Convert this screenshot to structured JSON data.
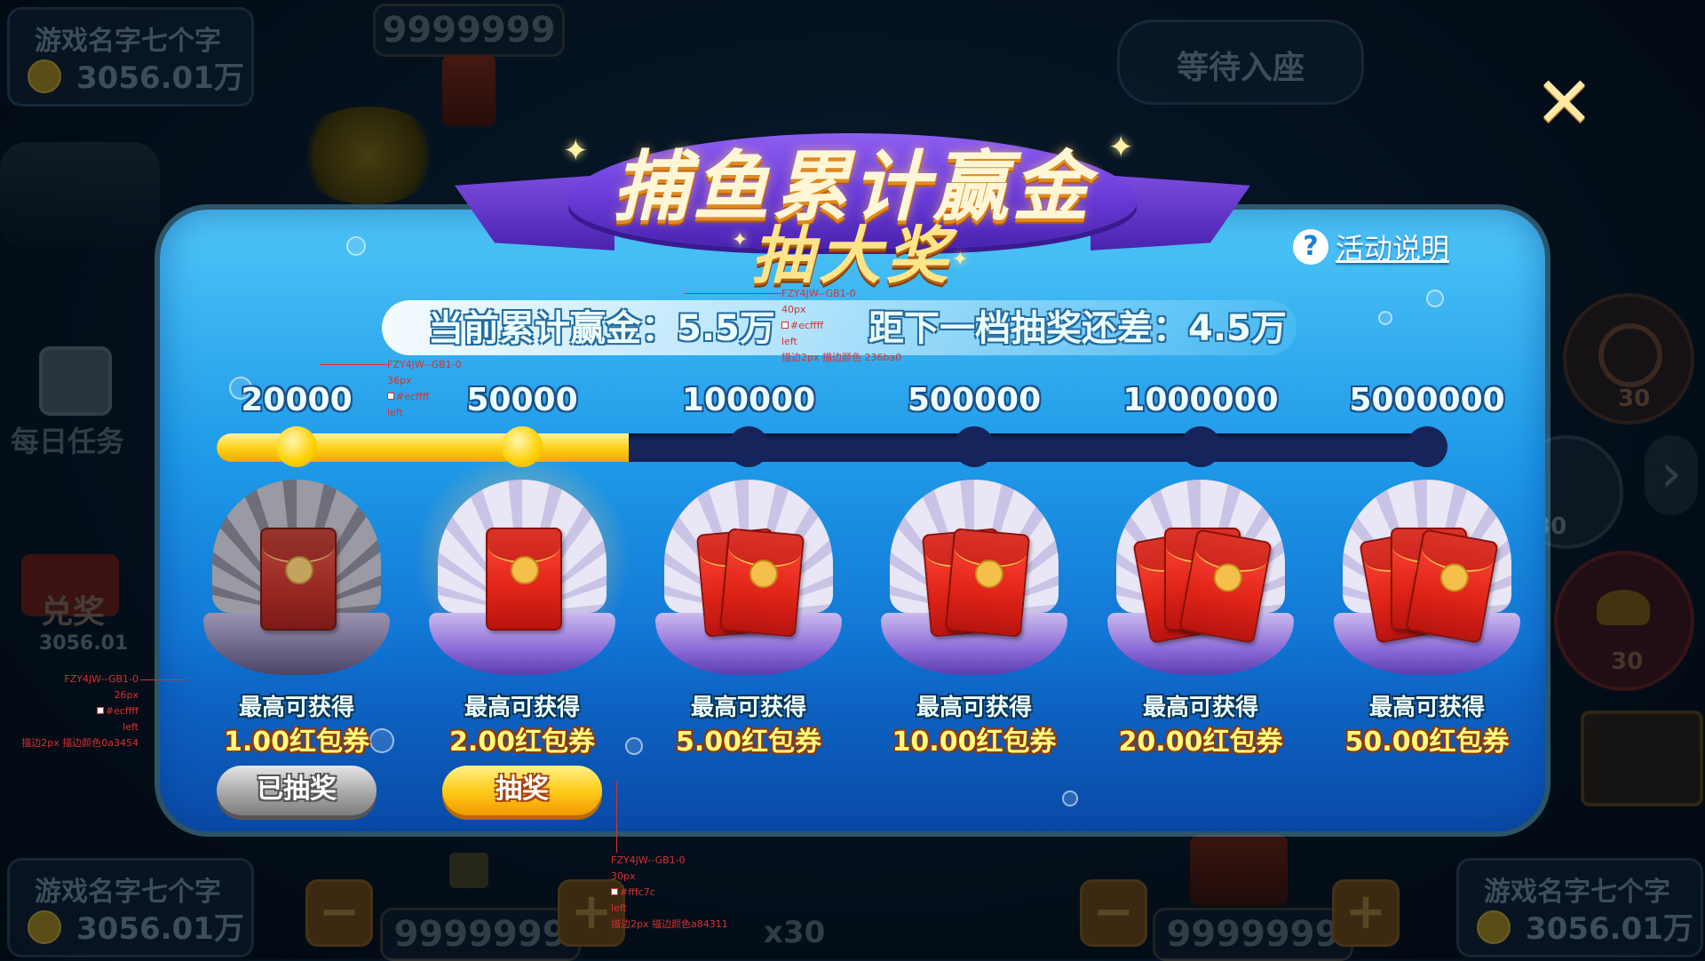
{
  "background": {
    "top_left_player": {
      "name": "游戏名字七个字",
      "amount": "3056.01万"
    },
    "top_center_counter": "9999999",
    "top_right_seat": "等待入座",
    "daily_task_label": "每日任务",
    "exchange_label": "兑奖",
    "exchange_value": "3056.01",
    "bottom_left_player": {
      "name": "游戏名字七个字",
      "amount": "3056.01万"
    },
    "bottom_right_player": {
      "name": "游戏名字七个字",
      "amount": "3056.01万"
    },
    "bottom_left_counter": "9999999",
    "bottom_right_counter": "9999999",
    "bet_multiplier": "x30",
    "skill_counts": [
      "30",
      "30",
      "30"
    ],
    "minus_label": "−",
    "plus_label": "+"
  },
  "panel": {
    "title_main": "捕鱼累计赢金",
    "title_sub": "抽大奖",
    "help_label": "活动说明",
    "help_icon": "?",
    "close_icon": "✕",
    "status": {
      "current_label": "当前累计赢金：",
      "current_value": "5.5万",
      "next_label": "距下一档抽奖还差：",
      "next_value": "4.5万"
    },
    "progress_fraction": 0.335,
    "tiers": [
      {
        "threshold": "20000",
        "reached": true,
        "caption": "最高可获得",
        "reward": "1.00红包券",
        "button": "已抽奖",
        "state": "claimed",
        "envelopes": 1
      },
      {
        "threshold": "50000",
        "reached": true,
        "caption": "最高可获得",
        "reward": "2.00红包券",
        "button": "抽奖",
        "state": "available",
        "envelopes": 1
      },
      {
        "threshold": "100000",
        "reached": false,
        "caption": "最高可获得",
        "reward": "5.00红包券",
        "button": "",
        "state": "locked",
        "envelopes": 2
      },
      {
        "threshold": "500000",
        "reached": false,
        "caption": "最高可获得",
        "reward": "10.00红包券",
        "button": "",
        "state": "locked",
        "envelopes": 2
      },
      {
        "threshold": "1000000",
        "reached": false,
        "caption": "最高可获得",
        "reward": "20.00红包券",
        "button": "",
        "state": "locked",
        "envelopes": 3
      },
      {
        "threshold": "5000000",
        "reached": false,
        "caption": "最高可获得",
        "reward": "50.00红包券",
        "button": "",
        "state": "locked",
        "envelopes": 3
      }
    ]
  },
  "annotations": {
    "status_spec": [
      "FZY4JW--GB1-0",
      "40px",
      "#ecffff",
      "left",
      "描边2px 描边颜色 236ba0"
    ],
    "tier_spec": [
      "FZY4JW--GB1-0",
      "36px",
      "#ecffff",
      "left"
    ],
    "caption_spec": [
      "FZY4JW--GB1-0",
      "26px",
      "#ecffff",
      "left",
      "描边2px  描边颜色0a3454"
    ],
    "button_spec": [
      "FZY4JW--GB1-0",
      "30px",
      "#fffc7c",
      "left",
      "描边2px 描边颜色a84311"
    ]
  },
  "colors": {
    "label_fill": "#ecffff",
    "reward_fill": "#fffc7c",
    "status_stroke": "#236ba0",
    "caption_stroke": "#0a3454",
    "button_stroke": "#a84311",
    "progress_fill": "#ffd21a",
    "progress_track": "#15245a"
  }
}
